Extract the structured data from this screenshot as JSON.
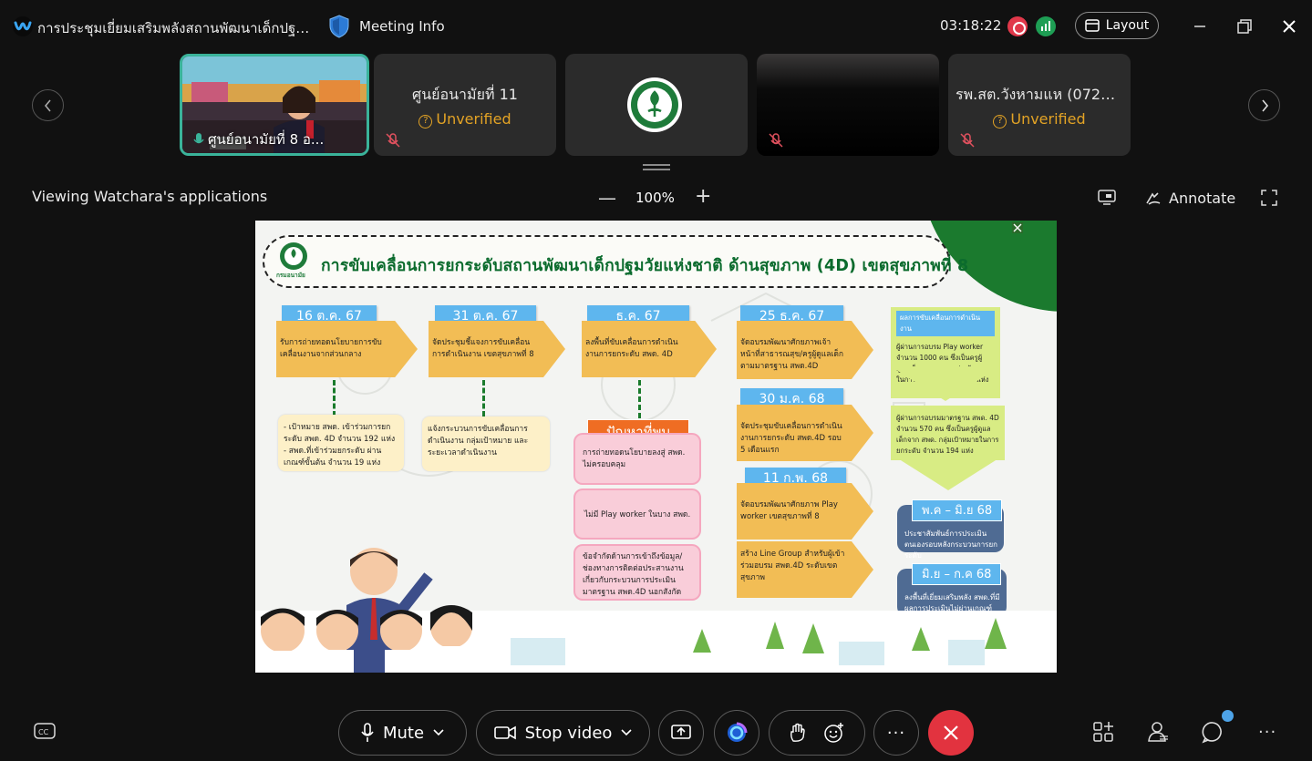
{
  "window": {
    "title": "การประชุมเยี่ยมเสริมพลังสถานพัฒนาเด็กปฐม...",
    "meeting_info": "Meeting Info",
    "clock": "03:18:22",
    "layout_label": "Layout"
  },
  "participants": [
    {
      "name": "ศูนย์อนามัยที่ 8 อ...",
      "status": "",
      "muted": true
    },
    {
      "name": "ศูนย์อนามัยที่ 11",
      "status": "Unverified",
      "muted": true
    },
    {
      "name": "",
      "status": "",
      "muted": false
    },
    {
      "name": "",
      "status": "",
      "muted": true
    },
    {
      "name": "รพ.สต.วังหามแห (0720...",
      "status": "Unverified",
      "muted": true
    }
  ],
  "share": {
    "viewing_label": "Viewing Watchara's applications",
    "zoom": "100%",
    "annotate_label": "Annotate"
  },
  "slide": {
    "logo_text": "กรมอนามัย",
    "title": "การขับเคลื่อนการยกระดับสถานพัฒนาเด็กปฐมวัยแห่งชาติ ด้านสุขภาพ (4D) เขตสุขภาพที่ 8",
    "col1": {
      "date": "16 ต.ค. 67",
      "text": "รับการถ่ายทอดนโยบายการขับเคลื่อนงานจากส่วนกลาง",
      "note": "- เป้าหมาย สพด. เข้าร่วมการยกระดับ สพด. 4D จำนวน 192 แห่ง - สพด.ที่เข้าร่วมยกระดับ ผ่านเกณฑ์ขั้นต้น จำนวน 19 แห่ง"
    },
    "col2": {
      "date": "31 ต.ค. 67",
      "text": "จัดประชุมชี้แจงการขับเคลื่อนการดำเนินงาน เขตสุขภาพที่ 8",
      "note": "แจ้งกระบวนการขับเคลื่อนการดำเนินงาน กลุ่มเป้าหมาย และระยะเวลาดำเนินงาน"
    },
    "col3": {
      "date": "ธ.ค. 67",
      "text": "ลงพื้นที่ขับเคลื่อนการดำเนินงานการยกระดับ สพด. 4D",
      "problem_label": "ปัญหาที่พบ",
      "problems": [
        "การถ่ายทอดนโยบายลงสู่ สพด. ไม่ครอบคลุม",
        "ไม่มี Play worker ในบาง สพด.",
        "ข้อจำกัดด้านการเข้าถึงข้อมูล/ช่องทางการติดต่อประสานงานเกี่ยวกับกระบวนการประเมินมาตรฐาน สพด.4D นอกสังกัด"
      ]
    },
    "col4": [
      {
        "date": "25 ธ.ค. 67",
        "text": "จัดอบรมพัฒนาศักยภาพเจ้าหน้าที่สาธารณสุข/ครูผู้ดูแลเด็ก ตามมาตรฐาน สพด.4D"
      },
      {
        "date": "30 ม.ค. 68",
        "text": "จัดประชุมขับเคลื่อนการดำเนินงานการยกระดับ สพด.4D รอบ 5 เดือนแรก"
      },
      {
        "date": "11 ก.พ. 68",
        "text": "จัดอบรมพัฒนาศักยภาพ Play worker เขตสุขภาพที่ 8"
      },
      {
        "date": "",
        "text": "สร้าง Line Group สำหรับผู้เข้าร่วมอบรม สพด.4D ระดับเขตสุขภาพ"
      }
    ],
    "col5": {
      "result_label": "ผลการขับเคลื่อนการดำเนินงาน",
      "result1": "ผู้ผ่านการอบรม Play worker จำนวน 1000 คน ซึ่งเป็นครูผู้ดูแลเด็กจาก สพด. กลุ่มเป้าหมายในการยกระดับ จำนวน 11 แห่ง",
      "result2": "ผู้ผ่านการอบรมมาตรฐาน สพด. 4D จำนวน 570 คน ซึ่งเป็นครูผู้ดูแลเด็กจาก สพด. กลุ่มเป้าหมายในการยกระดับ จำนวน 194 แห่ง",
      "plan1_label": "พ.ค – มิ.ย 68",
      "plan1_text": "ประชาสัมพันธ์การประเมินตนเองรอบหลังกระบวนการยกระดับ",
      "plan2_label": "มิ.ย – ก.ค 68",
      "plan2_text": "ลงพื้นที่เยี่ยมเสริมพลัง สพด.ที่มีผลการประเมินไม่ผ่านเกณฑ์รอบก่อนยกระดับ"
    }
  },
  "controls": {
    "mute_label": "Mute",
    "video_label": "Stop video"
  },
  "colors": {
    "accent_green": "#3ab39a",
    "end_red": "#e2333f",
    "unverified": "#e3a325"
  }
}
